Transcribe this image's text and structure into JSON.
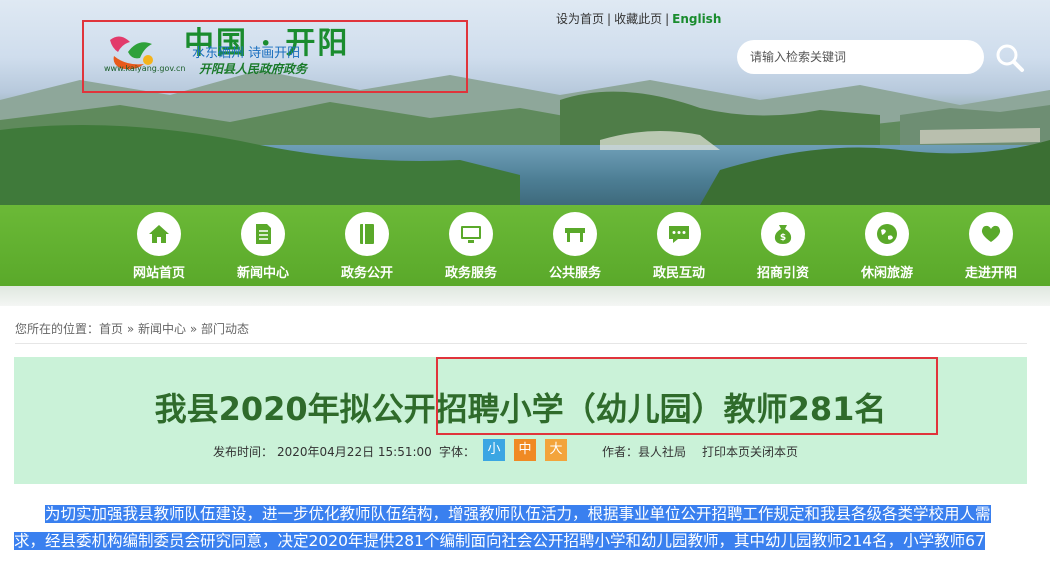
{
  "header": {
    "logo": {
      "title": "中国 · 开阳",
      "slogan": "水东硒州  诗画开阳",
      "url": "www.kaiyang.gov.cn",
      "subtitle": "开阳县人民政府政务"
    },
    "toplinks": {
      "home": "设为首页",
      "favorite": "收藏此页",
      "english": "English",
      "sep": "|"
    },
    "search": {
      "placeholder": "请输入检索关键词"
    }
  },
  "nav": {
    "items": [
      {
        "label": "网站首页",
        "icon": "home-icon"
      },
      {
        "label": "新闻中心",
        "icon": "document-icon"
      },
      {
        "label": "政务公开",
        "icon": "book-icon"
      },
      {
        "label": "政务服务",
        "icon": "monitor-icon"
      },
      {
        "label": "公共服务",
        "icon": "table-icon"
      },
      {
        "label": "政民互动",
        "icon": "chat-icon"
      },
      {
        "label": "招商引资",
        "icon": "money-bag-icon"
      },
      {
        "label": "休闲旅游",
        "icon": "globe-icon"
      },
      {
        "label": "走进开阳",
        "icon": "heart-icon"
      }
    ]
  },
  "breadcrumb": {
    "prefix": "您所在的位置：",
    "home": "首页",
    "sep": " » ",
    "news": "新闻中心",
    "dept": "部门动态"
  },
  "article": {
    "title": "我县2020年拟公开招聘小学（幼儿园）教师281名",
    "meta": {
      "publish_label": "发布时间：",
      "publish_time": "2020年04月22日 15:51:00",
      "font_label": "字体：",
      "font_small": "小",
      "font_medium": "中",
      "font_large": "大",
      "author_label": "作者：",
      "author": "县人社局",
      "print": "打印本页",
      "close": "关闭本页"
    },
    "paragraph_line1": "为切实加强我县教师队伍建设，进一步优化教师队伍结构，增强教师队伍活力，根据事业单位公开招聘工作规定和我县各级各类学校用人需",
    "paragraph_line2": "求，经县委机构编制委员会研究同意，决定2020年提供281个编制面向社会公开招聘小学和幼儿园教师，其中幼儿园教师214名，小学教师67"
  },
  "colors": {
    "nav_green": "#5aa92a",
    "title_green": "#2f6b2b",
    "header_bg": "#caf2d8",
    "highlight": "#e0343b",
    "selection": "#3a80ef"
  }
}
